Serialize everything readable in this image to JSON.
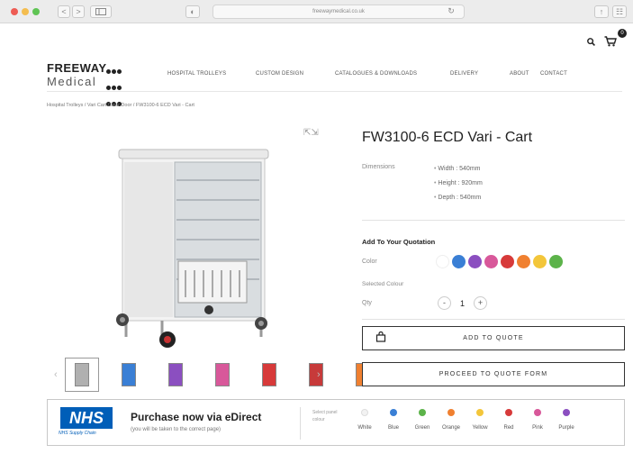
{
  "browser": {
    "url": "freewaymedical.co.uk",
    "back": "<",
    "forward": ">"
  },
  "header": {
    "logo_line1": "FREEWAY",
    "logo_line2": "Medical",
    "cart_count": "0",
    "nav": [
      "HOSPITAL TROLLEYS",
      "CUSTOM DESIGN",
      "CATALOGUES & DOWNLOADS",
      "DELIVERY",
      "ABOUT",
      "CONTACT"
    ]
  },
  "breadcrumb": "Hospital Trolleys / Vari Cart Clear Door / FW3100-6 ECD Vari - Cart",
  "product": {
    "title": "FW3100-6 ECD Vari - Cart",
    "dimensions_label": "Dimensions",
    "dimensions": [
      "Width : 540mm",
      "Height : 920mm",
      "Depth : 540mm"
    ],
    "add_heading": "Add To Your Quotation",
    "color_label": "Color",
    "selected_label": "Selected Colour",
    "qty_label": "Qty",
    "qty_value": "1",
    "minus": "-",
    "plus": "+",
    "swatch_colors": [
      "#ffffff",
      "#3a7fd5",
      "#8b4fc0",
      "#d8589a",
      "#d73a3a",
      "#f08030",
      "#f3c63a",
      "#5cb34a"
    ],
    "add_button": "ADD TO QUOTE",
    "proceed_button": "PROCEED TO QUOTE FORM",
    "thumb_colors": [
      "#999999",
      "#3a7fd5",
      "#8b4fc0",
      "#d8589a",
      "#d73a3a",
      "#d73a3a",
      "#f08030"
    ]
  },
  "nhs": {
    "logo": "NHS",
    "sub": "NHS Supply Chain",
    "title": "Purchase now via eDirect",
    "desc": "(you will be taken to the correct page)",
    "select_label": "Select panel colour",
    "colors": [
      {
        "name": "White",
        "hex": "#f2f2f2"
      },
      {
        "name": "Blue",
        "hex": "#3a7fd5"
      },
      {
        "name": "Green",
        "hex": "#5cb34a"
      },
      {
        "name": "Orange",
        "hex": "#f08030"
      },
      {
        "name": "Yellow",
        "hex": "#f3c63a"
      },
      {
        "name": "Red",
        "hex": "#d73a3a"
      },
      {
        "name": "Pink",
        "hex": "#d8589a"
      },
      {
        "name": "Purple",
        "hex": "#8b4fc0"
      }
    ]
  }
}
